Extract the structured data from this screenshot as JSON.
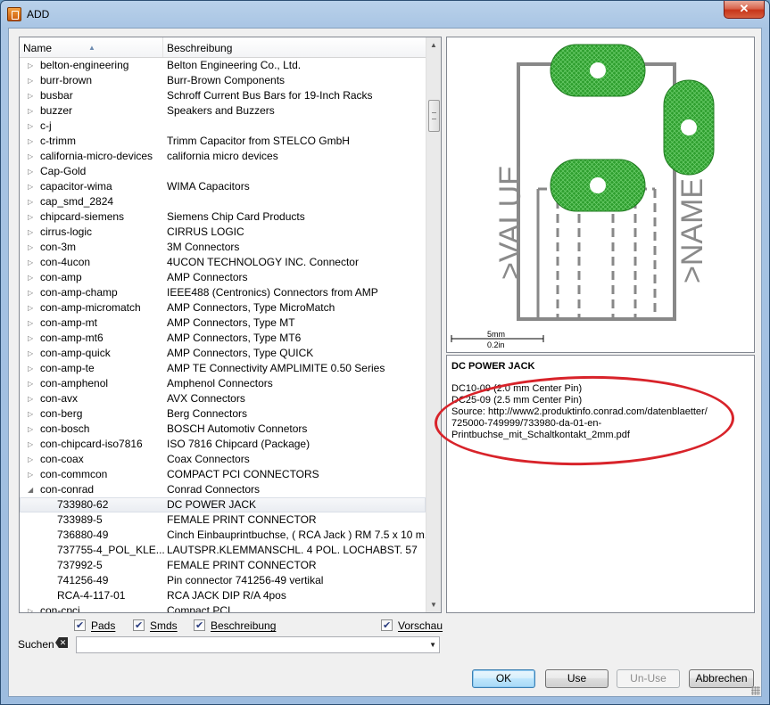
{
  "window": {
    "title": "ADD",
    "close_label": "✕"
  },
  "list": {
    "columns": {
      "name": "Name",
      "description": "Beschreibung"
    },
    "rows": [
      {
        "name": "belton-engineering",
        "desc": "Belton Engineering Co., Ltd.",
        "level": 0,
        "expander": "▷"
      },
      {
        "name": "burr-brown",
        "desc": "Burr-Brown Components",
        "level": 0,
        "expander": "▷"
      },
      {
        "name": "busbar",
        "desc": "Schroff Current Bus Bars for 19-Inch Racks",
        "level": 0,
        "expander": "▷"
      },
      {
        "name": "buzzer",
        "desc": "Speakers and Buzzers",
        "level": 0,
        "expander": "▷"
      },
      {
        "name": "c-j",
        "desc": "",
        "level": 0,
        "expander": "▷"
      },
      {
        "name": "c-trimm",
        "desc": "Trimm Capacitor from STELCO GmbH",
        "level": 0,
        "expander": "▷"
      },
      {
        "name": "california-micro-devices",
        "desc": "california micro devices",
        "level": 0,
        "expander": "▷"
      },
      {
        "name": "Cap-Gold",
        "desc": "",
        "level": 0,
        "expander": "▷"
      },
      {
        "name": "capacitor-wima",
        "desc": "WIMA Capacitors",
        "level": 0,
        "expander": "▷"
      },
      {
        "name": "cap_smd_2824",
        "desc": "",
        "level": 0,
        "expander": "▷"
      },
      {
        "name": "chipcard-siemens",
        "desc": "Siemens Chip Card Products",
        "level": 0,
        "expander": "▷"
      },
      {
        "name": "cirrus-logic",
        "desc": "CIRRUS LOGIC",
        "level": 0,
        "expander": "▷"
      },
      {
        "name": "con-3m",
        "desc": "3M Connectors",
        "level": 0,
        "expander": "▷"
      },
      {
        "name": "con-4ucon",
        "desc": "4UCON TECHNOLOGY INC. Connector",
        "level": 0,
        "expander": "▷"
      },
      {
        "name": "con-amp",
        "desc": "AMP Connectors",
        "level": 0,
        "expander": "▷"
      },
      {
        "name": "con-amp-champ",
        "desc": "IEEE488 (Centronics) Connectors from AMP",
        "level": 0,
        "expander": "▷"
      },
      {
        "name": "con-amp-micromatch",
        "desc": "AMP Connectors, Type  MicroMatch",
        "level": 0,
        "expander": "▷"
      },
      {
        "name": "con-amp-mt",
        "desc": "AMP Connectors, Type MT",
        "level": 0,
        "expander": "▷"
      },
      {
        "name": "con-amp-mt6",
        "desc": "AMP Connectors, Type MT6",
        "level": 0,
        "expander": "▷"
      },
      {
        "name": "con-amp-quick",
        "desc": "AMP Connectors, Type QUICK",
        "level": 0,
        "expander": "▷"
      },
      {
        "name": "con-amp-te",
        "desc": "AMP TE Connectivity AMPLIMITE 0.50 Series",
        "level": 0,
        "expander": "▷"
      },
      {
        "name": "con-amphenol",
        "desc": "Amphenol Connectors",
        "level": 0,
        "expander": "▷"
      },
      {
        "name": "con-avx",
        "desc": "AVX Connectors",
        "level": 0,
        "expander": "▷"
      },
      {
        "name": "con-berg",
        "desc": "Berg Connectors",
        "level": 0,
        "expander": "▷"
      },
      {
        "name": "con-bosch",
        "desc": "BOSCH Automotiv Connetors",
        "level": 0,
        "expander": "▷"
      },
      {
        "name": "con-chipcard-iso7816",
        "desc": "ISO 7816 Chipcard (Package)",
        "level": 0,
        "expander": "▷"
      },
      {
        "name": "con-coax",
        "desc": "Coax Connectors",
        "level": 0,
        "expander": "▷"
      },
      {
        "name": "con-commcon",
        "desc": "COMPACT PCI CONNECTORS",
        "level": 0,
        "expander": "▷"
      },
      {
        "name": "con-conrad",
        "desc": "Conrad Connectors",
        "level": 0,
        "expander": "◢"
      },
      {
        "name": "733980-62",
        "desc": "DC POWER JACK",
        "level": 1,
        "expander": "",
        "selected": true
      },
      {
        "name": "733989-5",
        "desc": "FEMALE PRINT CONNECTOR",
        "level": 1,
        "expander": ""
      },
      {
        "name": "736880-49",
        "desc": "Cinch Einbauprintbuchse, ( RCA Jack ) RM 7.5 x 10 m...",
        "level": 1,
        "expander": ""
      },
      {
        "name": "737755-4_POL_KLE...",
        "desc": "LAUTSPR.KLEMMANSCHL. 4 POL. LOCHABST. 57",
        "level": 1,
        "expander": ""
      },
      {
        "name": "737992-5",
        "desc": "FEMALE PRINT CONNECTOR",
        "level": 1,
        "expander": ""
      },
      {
        "name": "741256-49",
        "desc": "Pin connector 741256-49 vertikal",
        "level": 1,
        "expander": ""
      },
      {
        "name": "RCA-4-117-01",
        "desc": "RCA JACK DIP R/A 4pos",
        "level": 1,
        "expander": ""
      },
      {
        "name": "con-cpci",
        "desc": "Compact PCI",
        "level": 0,
        "expander": "▷"
      }
    ]
  },
  "preview": {
    "value_text": ">VALUE",
    "name_text": ">NAME",
    "scale_mm": "5mm",
    "scale_in": "0.2in",
    "pad_color": "#2e9e2e"
  },
  "description": {
    "title": "DC POWER JACK",
    "lines": [
      "DC10-09 (2.0 mm Center Pin)",
      "DC25-09 (2.5 mm Center Pin)",
      "Source: http://www2.produktinfo.conrad.com/datenblaetter/",
      "725000-749999/733980-da-01-en-",
      "Printbuchse_mit_Schaltkontakt_2mm.pdf"
    ]
  },
  "options": {
    "pads": "Pads",
    "smds": "Smds",
    "beschreibung": "Beschreibung",
    "vorschau": "Vorschau"
  },
  "search": {
    "label": "Suchen",
    "value": ""
  },
  "buttons": {
    "ok": "OK",
    "use": "Use",
    "unuse": "Un-Use",
    "cancel": "Abbrechen"
  }
}
